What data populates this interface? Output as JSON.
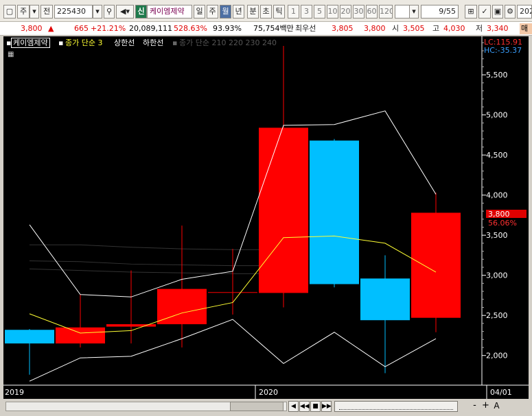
{
  "toolbar": {
    "market": "주",
    "prev": "전",
    "code": "225430",
    "badge": "신",
    "name": "케이엠제약",
    "periods": [
      "일",
      "주",
      "월",
      "년",
      "분",
      "초",
      "틱"
    ],
    "active_period": "월",
    "intervals": [
      "1",
      "3",
      "5",
      "10",
      "20",
      "30",
      "60",
      "120"
    ],
    "counter": "9/55",
    "right_code": "202"
  },
  "quote": {
    "price": "3,800",
    "change": "665",
    "change_pct": "+21.21%",
    "volume": "20,089,111",
    "vol_ratio": "528.63%",
    "pct2": "93.93%",
    "amount": "75,754백만",
    "pref_label": "최우선",
    "pref1": "3,805",
    "pref2": "3,800",
    "open_label": "시",
    "open": "3,505",
    "high_label": "고",
    "high": "4,030",
    "low_label": "저",
    "low": "3,340",
    "extra": "매"
  },
  "legend": {
    "title": "케이엠제약",
    "item1": "종가 단순 3",
    "item2": "상한선",
    "item3": "하한선",
    "item4": "종가 단순 210 220 230 240"
  },
  "chart_data": {
    "type": "candlestick",
    "ylim": [
      1630,
      5980
    ],
    "yticks": [
      "5,500",
      "5,000",
      "4,500",
      "4,000",
      "3,500",
      "3,000",
      "2,500",
      "2,000"
    ],
    "x_labels": [
      "2019",
      "2020",
      "04/01"
    ],
    "lc_label": "LC:115.91",
    "hc_label": "HC:-35.37",
    "current_price": "3,800",
    "current_pct": "56.06%",
    "candles": [
      {
        "open": 2320,
        "close": 2150,
        "high": 2330,
        "low": 1760
      },
      {
        "open": 2150,
        "close": 2350,
        "high": 2760,
        "low": 2100
      },
      {
        "open": 2360,
        "close": 2390,
        "high": 3060,
        "low": 2150
      },
      {
        "open": 2390,
        "close": 2830,
        "high": 3620,
        "low": 2100
      },
      {
        "open": 2790,
        "close": 2790,
        "high": 3330,
        "low": 2510
      },
      {
        "open": 2780,
        "close": 4840,
        "high": 5860,
        "low": 2600
      },
      {
        "open": 4680,
        "close": 2890,
        "high": 4700,
        "low": 2850
      },
      {
        "open": 2960,
        "close": 2440,
        "high": 3250,
        "low": 1780
      },
      {
        "open": 2470,
        "close": 3780,
        "high": 4030,
        "low": 2290
      }
    ],
    "series": [
      {
        "name": "종가 단순 3",
        "values": [
          2520,
          2280,
          2310,
          2530,
          2660,
          3470,
          3490,
          3400,
          3040
        ]
      },
      {
        "name": "상한선",
        "values": [
          3630,
          2760,
          2730,
          2950,
          3050,
          4870,
          4880,
          5050,
          4010
        ]
      },
      {
        "name": "하한선",
        "values": [
          1680,
          1970,
          1990,
          2210,
          2450,
          1900,
          2290,
          1860,
          2210
        ]
      }
    ],
    "colors": {
      "up": "#ff0000",
      "down": "#00bfff",
      "ma": "#ffff33",
      "band": "#ffffff",
      "grid": "#ffffff"
    }
  },
  "bottom": {
    "buttons": [
      "◀",
      "◀◀",
      "■",
      "▶▶",
      "-",
      "+",
      "A"
    ]
  }
}
